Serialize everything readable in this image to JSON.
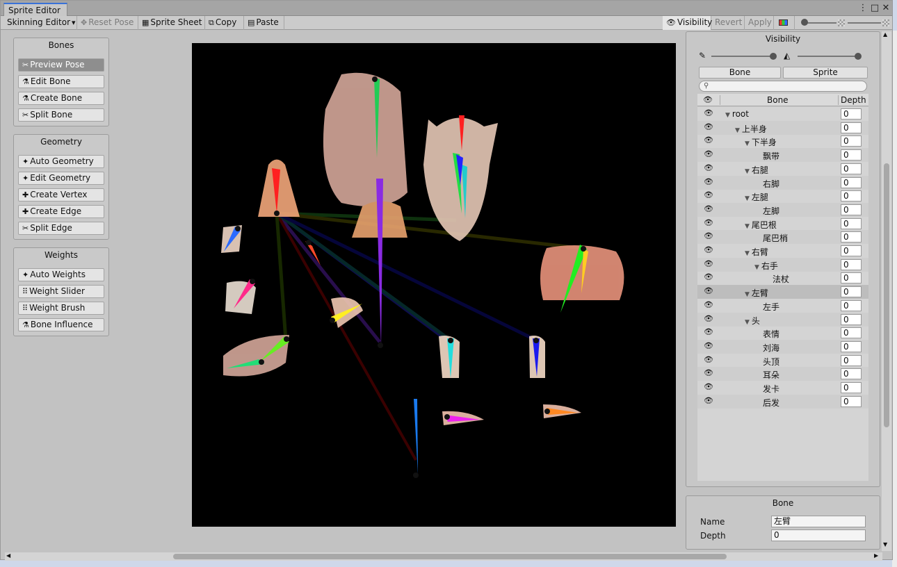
{
  "window": {
    "tab_title": "Sprite Editor"
  },
  "toolbar": {
    "mode_dropdown": "Skinning Editor",
    "reset_pose": "Reset Pose",
    "sprite_sheet": "Sprite Sheet",
    "copy": "Copy",
    "paste": "Paste",
    "visibility": "Visibility",
    "revert": "Revert",
    "apply": "Apply"
  },
  "bones_panel": {
    "title": "Bones",
    "items": [
      "Preview Pose",
      "Edit Bone",
      "Create Bone",
      "Split Bone"
    ]
  },
  "geometry_panel": {
    "title": "Geometry",
    "items": [
      "Auto Geometry",
      "Edit Geometry",
      "Create Vertex",
      "Create Edge",
      "Split Edge"
    ]
  },
  "weights_panel": {
    "title": "Weights",
    "items": [
      "Auto Weights",
      "Weight Slider",
      "Weight Brush",
      "Bone Influence"
    ]
  },
  "visibility_panel": {
    "title": "Visibility",
    "tab_bone": "Bone",
    "tab_sprite": "Sprite",
    "col_bone": "Bone",
    "col_depth": "Depth",
    "rows": [
      {
        "name": "root",
        "depth": "0"
      },
      {
        "name": "上半身",
        "depth": "0"
      },
      {
        "name": "下半身",
        "depth": "0"
      },
      {
        "name": "飘带",
        "depth": "0"
      },
      {
        "name": "右腿",
        "depth": "0"
      },
      {
        "name": "右脚",
        "depth": "0"
      },
      {
        "name": "左腿",
        "depth": "0"
      },
      {
        "name": "左脚",
        "depth": "0"
      },
      {
        "name": "尾巴根",
        "depth": "0"
      },
      {
        "name": "尾巴梢",
        "depth": "0"
      },
      {
        "name": "右臂",
        "depth": "0"
      },
      {
        "name": "右手",
        "depth": "0"
      },
      {
        "name": "法杖",
        "depth": "0"
      },
      {
        "name": "左臂",
        "depth": "0"
      },
      {
        "name": "左手",
        "depth": "0"
      },
      {
        "name": "头",
        "depth": "0"
      },
      {
        "name": "表情",
        "depth": "0"
      },
      {
        "name": "刘海",
        "depth": "0"
      },
      {
        "name": "头顶",
        "depth": "0"
      },
      {
        "name": "耳朵",
        "depth": "0"
      },
      {
        "name": "发卡",
        "depth": "0"
      },
      {
        "name": "后发",
        "depth": "0"
      }
    ]
  },
  "bone_panel": {
    "title": "Bone",
    "name_label": "Name",
    "name_value": "左臂",
    "depth_label": "Depth",
    "depth_value": "0"
  }
}
